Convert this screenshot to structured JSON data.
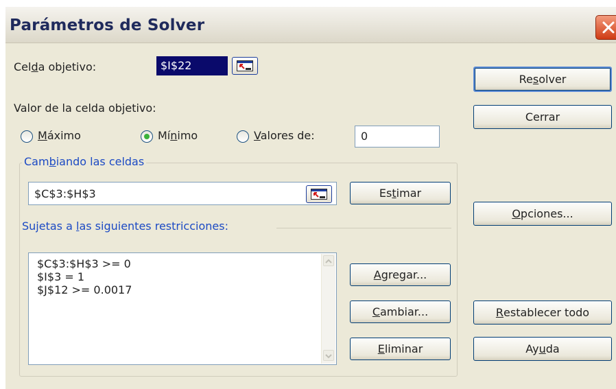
{
  "title": "Parámetros de Solver",
  "target": {
    "label_pre": "Cel",
    "label_key": "d",
    "label_post": "a objetivo:",
    "value": "$I$22"
  },
  "equal_to": {
    "label": "Valor de la celda objetivo:"
  },
  "options": [
    {
      "key": "M",
      "rest": "áximo",
      "selected": false
    },
    {
      "pre": "Mí",
      "key": "n",
      "post": "imo",
      "selected": true
    },
    {
      "key": "V",
      "rest": "alores de:",
      "selected": false
    }
  ],
  "value_of": "0",
  "changing": {
    "label_pre": "Cam",
    "label_key": "b",
    "label_post": "iando las celdas",
    "value": "$C$3:$H$3"
  },
  "constraints": {
    "label_pre": "Sujetas a ",
    "label_key": "l",
    "label_post": "as siguientes restricciones:",
    "items": [
      "$C$3:$H$3 >= 0",
      "$I$3 = 1",
      "$J$12 >= 0.0017"
    ]
  },
  "buttons": {
    "solve": {
      "pre": "Re",
      "key": "s",
      "post": "olver"
    },
    "close": {
      "pre": "",
      "key": "",
      "post": "Cerrar"
    },
    "guess": {
      "pre": "Es",
      "key": "t",
      "post": "imar"
    },
    "options": {
      "pre": "",
      "key": "O",
      "post": "pciones..."
    },
    "add": {
      "pre": "",
      "key": "A",
      "post": "gregar..."
    },
    "change": {
      "pre": "",
      "key": "C",
      "post": "ambiar..."
    },
    "delete": {
      "pre": "",
      "key": "E",
      "post": "liminar"
    },
    "reset": {
      "pre": "",
      "key": "R",
      "post": "establecer todo"
    },
    "help": {
      "pre": "Ay",
      "key": "u",
      "post": "da"
    }
  },
  "colors": {
    "group_label": "#1c4ac4",
    "selected_radio": "#3bb23b",
    "target_highlight": "#0a0a6b"
  },
  "icons": {
    "close": "close-icon",
    "ref": "cell-reference-icon"
  }
}
